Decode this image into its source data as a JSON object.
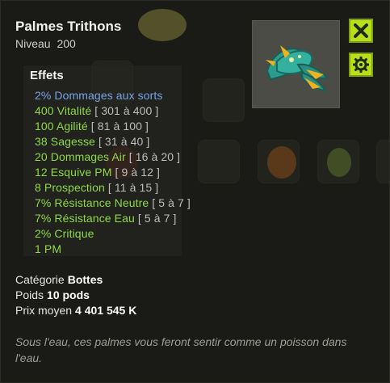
{
  "item": {
    "name": "Palmes Trithons",
    "level_label": "Niveau",
    "level_value": "200"
  },
  "buttons": {
    "close_icon": "close-icon",
    "gear_icon": "gear-icon"
  },
  "effects": {
    "title": "Effets",
    "list": [
      {
        "text": "2% Dommages aux sorts",
        "range": "",
        "color": "#77a3e6"
      },
      {
        "text": "400 Vitalité",
        "range": "[ 301 à 400 ]",
        "color": "#8fd94a"
      },
      {
        "text": "100 Agilité",
        "range": "[ 81 à 100 ]",
        "color": "#8fd94a"
      },
      {
        "text": "38 Sagesse",
        "range": "[ 31 à 40 ]",
        "color": "#8fd94a"
      },
      {
        "text": "20 Dommages Air",
        "range": "[ 16 à 20 ]",
        "color": "#8fd94a"
      },
      {
        "text": "12 Esquive PM",
        "range": "[ 9 à 12 ]",
        "color": "#8fd94a"
      },
      {
        "text": "8 Prospection",
        "range": "[ 11 à 15 ]",
        "color": "#8fd94a"
      },
      {
        "text": "7% Résistance Neutre",
        "range": "[ 5 à 7 ]",
        "color": "#8fd94a"
      },
      {
        "text": "7% Résistance Eau",
        "range": "[ 5 à 7 ]",
        "color": "#8fd94a"
      },
      {
        "text": "2% Critique",
        "range": "",
        "color": "#8fd94a"
      },
      {
        "text": "1 PM",
        "range": "",
        "color": "#8fd94a"
      }
    ]
  },
  "properties": {
    "category_label": "Catégorie",
    "category_value": "Bottes",
    "weight_label": "Poids",
    "weight_value": "10 pods",
    "price_label": "Prix moyen",
    "price_value": "4 401 545 K"
  },
  "description": "Sous l'eau, ces palmes vous feront sentir comme un poisson dans l'eau.",
  "colors": {
    "accent_button": "#b8e01a",
    "effect_blue": "#77a3e6",
    "effect_green": "#8fd94a"
  }
}
